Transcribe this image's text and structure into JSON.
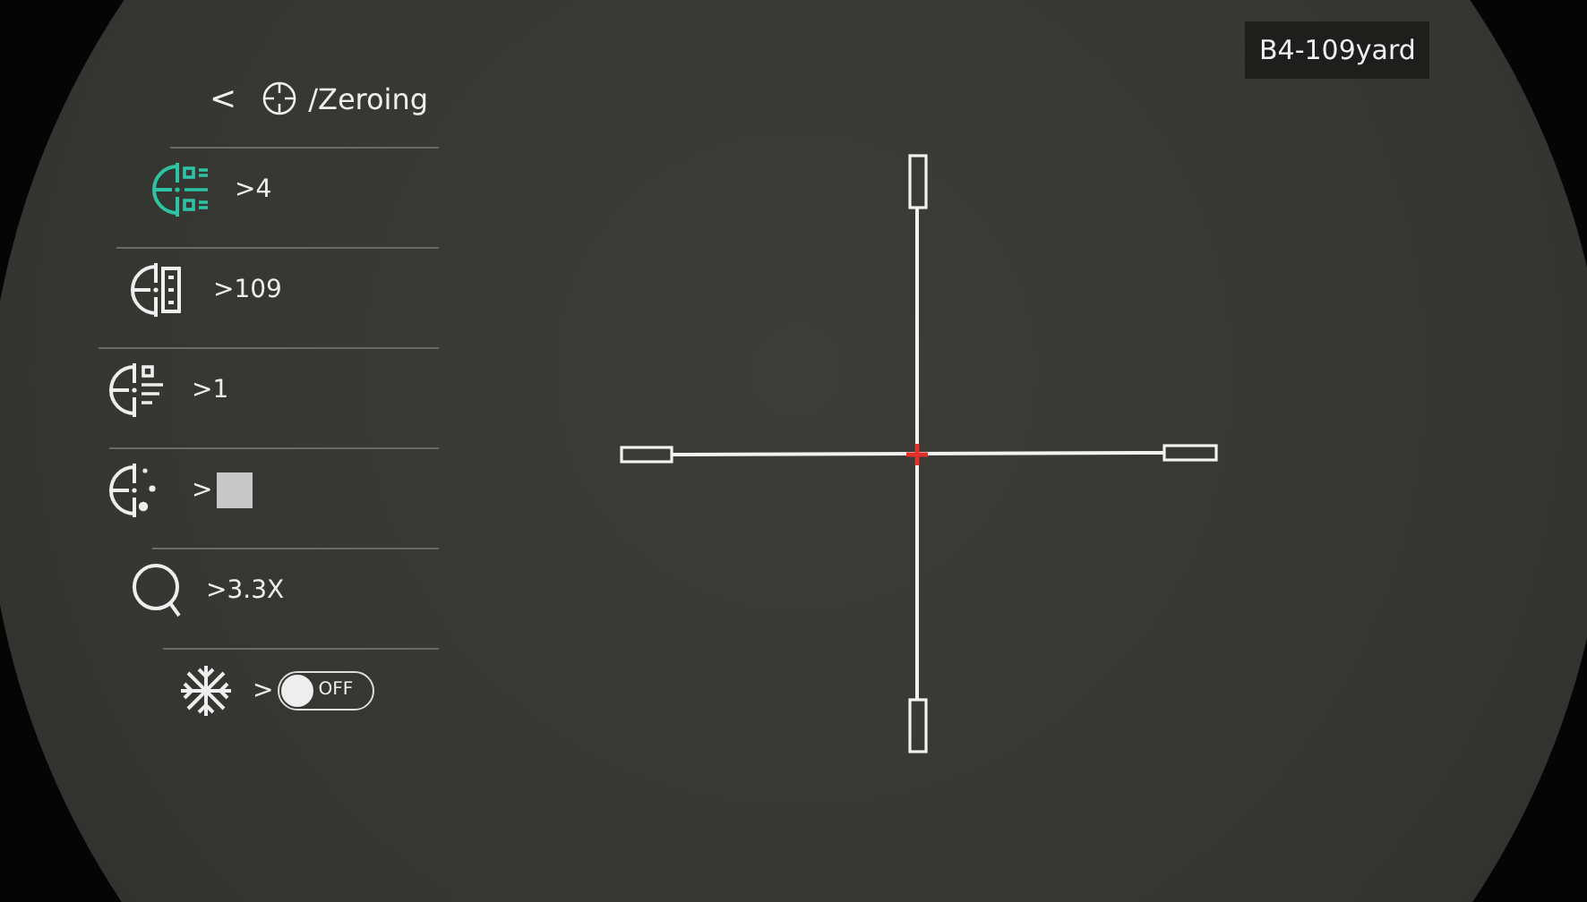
{
  "header": {
    "back": "<",
    "title": "/Zeroing"
  },
  "items": [
    {
      "kind": "text",
      "value": ">4",
      "selected": true
    },
    {
      "kind": "text",
      "value": ">109",
      "selected": false
    },
    {
      "kind": "text",
      "value": ">1",
      "selected": false
    },
    {
      "kind": "swatch",
      "value": ">",
      "color": "#c8c8c8",
      "selected": false
    },
    {
      "kind": "text",
      "value": ">3.3X",
      "selected": false
    },
    {
      "kind": "toggle",
      "value": ">",
      "toggle_label": "OFF",
      "on": false,
      "selected": false
    }
  ],
  "profile_label": "B4-109yard"
}
